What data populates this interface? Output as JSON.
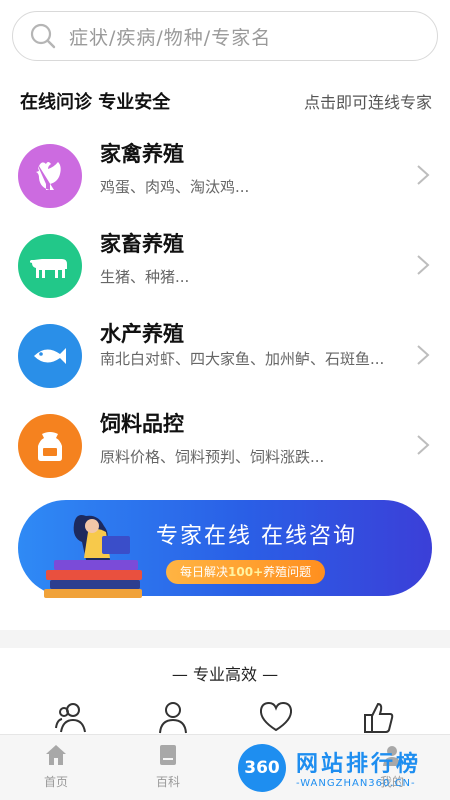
{
  "search": {
    "placeholder": "症状/疾病/物种/专家名"
  },
  "header": {
    "title": "在线问诊 专业安全",
    "link": "点击即可连线专家"
  },
  "categories": [
    {
      "title": "家禽养殖",
      "sub": "鸡蛋、肉鸡、淘汰鸡...",
      "color": "#cc6be0",
      "icon": "rooster-icon"
    },
    {
      "title": "家畜养殖",
      "sub": "生猪、种猪...",
      "color": "#22c889",
      "icon": "cow-icon"
    },
    {
      "title": "水产养殖",
      "sub": "南北白对虾、四大家鱼、加州鲈、石斑鱼...",
      "color": "#2a8fe8",
      "icon": "fish-icon"
    },
    {
      "title": "饲料品控",
      "sub": "原料价格、饲料预判、饲料涨跌...",
      "color": "#f5821f",
      "icon": "feed-bag-icon"
    }
  ],
  "banner": {
    "title": "专家在线   在线咨询",
    "tag_prefix": "每日解决",
    "tag_number": "100+",
    "tag_suffix": "养殖问题"
  },
  "section": {
    "title": "—  专业高效  —"
  },
  "tabs": [
    {
      "label": "首页",
      "icon": "home-icon"
    },
    {
      "label": "百科",
      "icon": "book-icon"
    },
    {
      "label": "我的",
      "icon": "user-icon"
    }
  ],
  "watermark": {
    "badge": "360",
    "big": "网站排行榜",
    "small": "-WANGZHAN360.CN-"
  }
}
